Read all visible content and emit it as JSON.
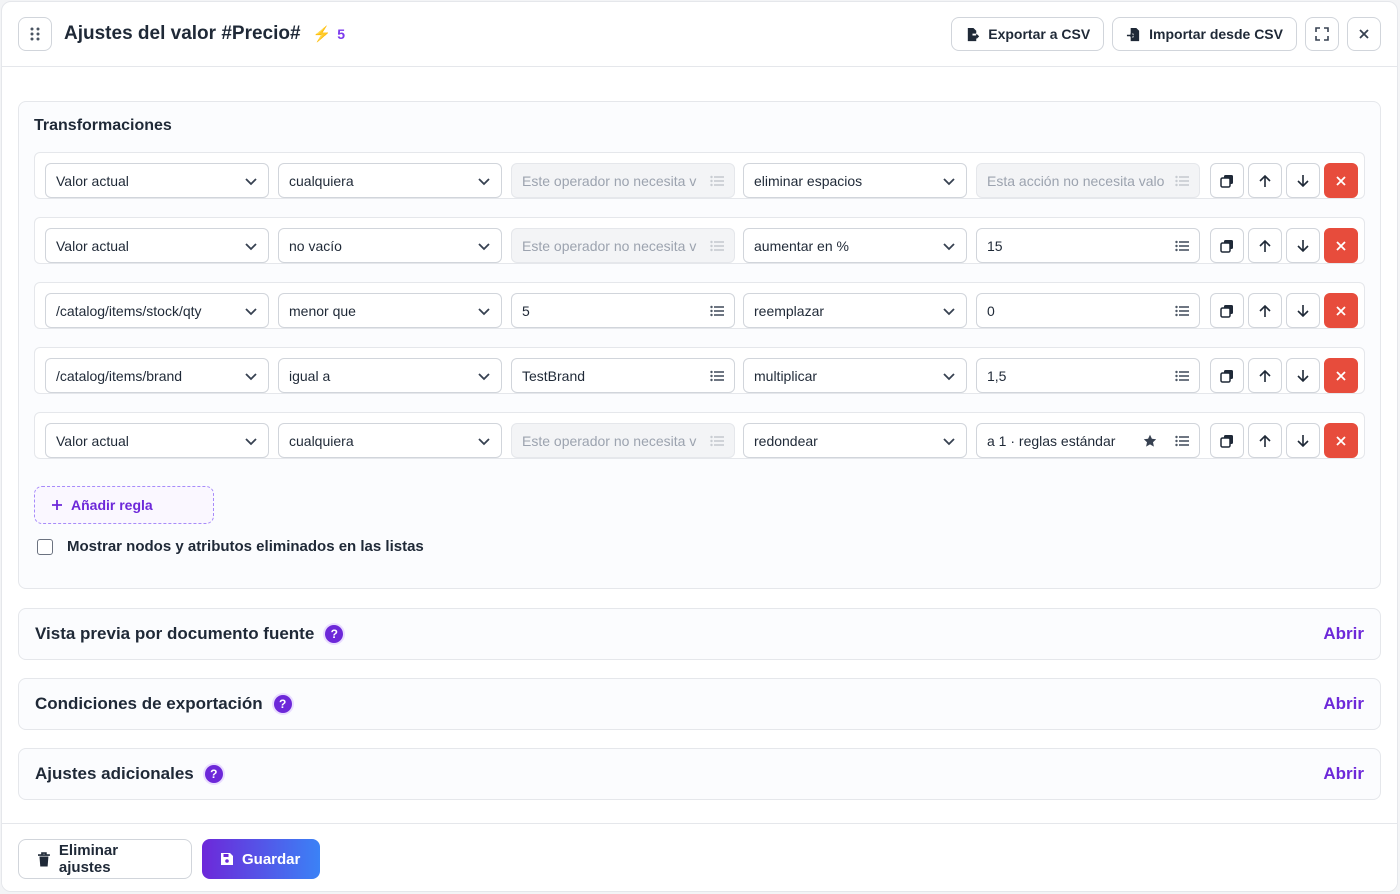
{
  "header": {
    "title": "Ajustes del valor #Precio#",
    "count": "5",
    "export_label": "Exportar a CSV",
    "import_label": "Importar desde CSV"
  },
  "transformations": {
    "title": "Transformaciones",
    "rules": [
      {
        "source": "Valor actual",
        "operator": "cualquiera",
        "value": "Este operador no necesita v",
        "value_disabled": true,
        "action": "eliminar espacios",
        "action_value": "Esta acción no necesita valo",
        "action_value_disabled": true,
        "starred": false
      },
      {
        "source": "Valor actual",
        "operator": "no vacío",
        "value": "Este operador no necesita v",
        "value_disabled": true,
        "action": "aumentar en %",
        "action_value": "15",
        "action_value_disabled": false,
        "starred": false
      },
      {
        "source": "/catalog/items/stock/qty",
        "operator": "menor que",
        "value": "5",
        "value_disabled": false,
        "action": "reemplazar",
        "action_value": "0",
        "action_value_disabled": false,
        "starred": false
      },
      {
        "source": "/catalog/items/brand",
        "operator": "igual a",
        "value": "TestBrand",
        "value_disabled": false,
        "action": "multiplicar",
        "action_value": "1,5",
        "action_value_disabled": false,
        "starred": false
      },
      {
        "source": "Valor actual",
        "operator": "cualquiera",
        "value": "Este operador no necesita v",
        "value_disabled": true,
        "action": "redondear",
        "action_value": "a 1 · reglas estándar",
        "action_value_disabled": false,
        "starred": true
      }
    ],
    "add_rule_label": "Añadir regla",
    "show_deleted_label": "Mostrar nodos y atributos eliminados en las listas"
  },
  "accordions": [
    {
      "title": "Vista previa por documento fuente",
      "help": "?",
      "action": "Abrir"
    },
    {
      "title": "Condiciones de exportación",
      "help": "?",
      "action": "Abrir"
    },
    {
      "title": "Ajustes adicionales",
      "help": "?",
      "action": "Abrir"
    }
  ],
  "footer": {
    "delete_label": "Eliminar ajustes",
    "save_label": "Guardar"
  },
  "colors": {
    "accent": "#6d28d9",
    "danger": "#e74c3c",
    "bolt": "#f59e0b"
  }
}
